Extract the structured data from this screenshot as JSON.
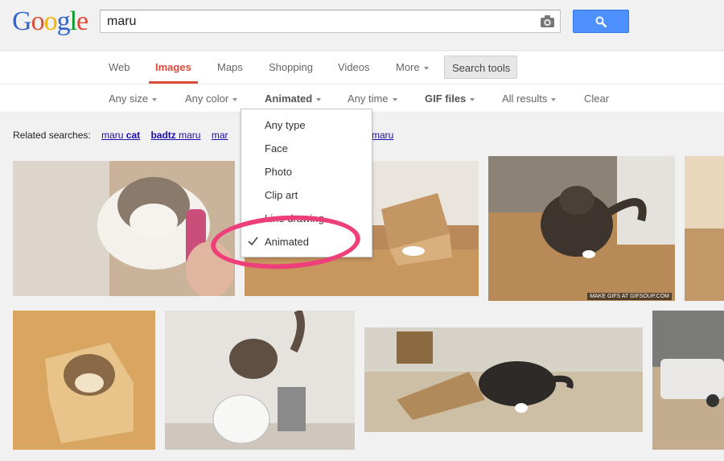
{
  "logo": {
    "text": "Google",
    "letters": [
      {
        "ch": "G",
        "color": "#3366cc"
      },
      {
        "ch": "o",
        "color": "#dd4b39"
      },
      {
        "ch": "o",
        "color": "#f4b400"
      },
      {
        "ch": "g",
        "color": "#3366cc"
      },
      {
        "ch": "l",
        "color": "#009925"
      },
      {
        "ch": "e",
        "color": "#dd4b39"
      }
    ]
  },
  "search": {
    "query": "maru"
  },
  "tabs": [
    {
      "label": "Web"
    },
    {
      "label": "Images"
    },
    {
      "label": "Maps"
    },
    {
      "label": "Shopping"
    },
    {
      "label": "Videos"
    },
    {
      "label": "More"
    }
  ],
  "search_tools_label": "Search tools",
  "tools": [
    {
      "label": "Any size"
    },
    {
      "label": "Any color"
    },
    {
      "label": "Animated"
    },
    {
      "label": "Any time"
    },
    {
      "label": "GIF files"
    },
    {
      "label": "All results"
    },
    {
      "label": "Clear"
    }
  ],
  "related": {
    "label": "Related searches:",
    "items": [
      {
        "normal": "maru ",
        "bold": "cat"
      },
      {
        "bold": "badtz",
        "normal": " maru"
      },
      {
        "normal": "mar"
      },
      {
        "normal": "maru"
      }
    ]
  },
  "type_menu": {
    "items": [
      {
        "label": "Any type"
      },
      {
        "label": "Face"
      },
      {
        "label": "Photo"
      },
      {
        "label": "Clip art"
      },
      {
        "label": "Line drawing"
      },
      {
        "label": "Animated"
      }
    ],
    "selected": "Animated"
  },
  "watermark": "MAKE GIFS AT GIFSOUP.COM",
  "colors": {
    "accent_red": "#dd4b39",
    "button_blue": "#4d90fe",
    "highlight": "#ef3f7b",
    "link": "#1a0dab"
  }
}
